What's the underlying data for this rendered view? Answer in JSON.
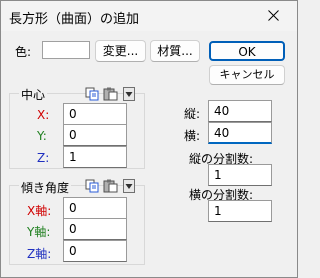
{
  "window": {
    "title": "長方形（曲面）の追加",
    "close_symbol": "✕"
  },
  "color": {
    "label": "色:",
    "change_button": "変更...",
    "material_button": "材質..."
  },
  "buttons": {
    "ok": "OK",
    "cancel": "キャンセル"
  },
  "center": {
    "label": "中心",
    "fields": [
      {
        "label": "X:",
        "value": "0"
      },
      {
        "label": "Y:",
        "value": "0"
      },
      {
        "label": "Z:",
        "value": "1"
      }
    ]
  },
  "tilt": {
    "label": "傾き角度",
    "fields": [
      {
        "label": "X軸:",
        "value": "0"
      },
      {
        "label": "Y軸:",
        "value": "0"
      },
      {
        "label": "Z軸:",
        "value": "0"
      }
    ]
  },
  "size": {
    "height_label": "縦:",
    "height_value": "40",
    "width_label": "横:",
    "width_value": "40",
    "vdiv_label": "縦の分割数:",
    "vdiv_value": "1",
    "hdiv_label": "横の分割数:",
    "hdiv_value": "1"
  },
  "colors": {
    "x_axis": "#d00000",
    "y_axis": "#208020",
    "z_axis": "#2030c0",
    "accent": "#005fb8"
  },
  "icons": [
    "copy-icon",
    "paste-icon",
    "dropdown-arrow-icon",
    "close-icon"
  ]
}
